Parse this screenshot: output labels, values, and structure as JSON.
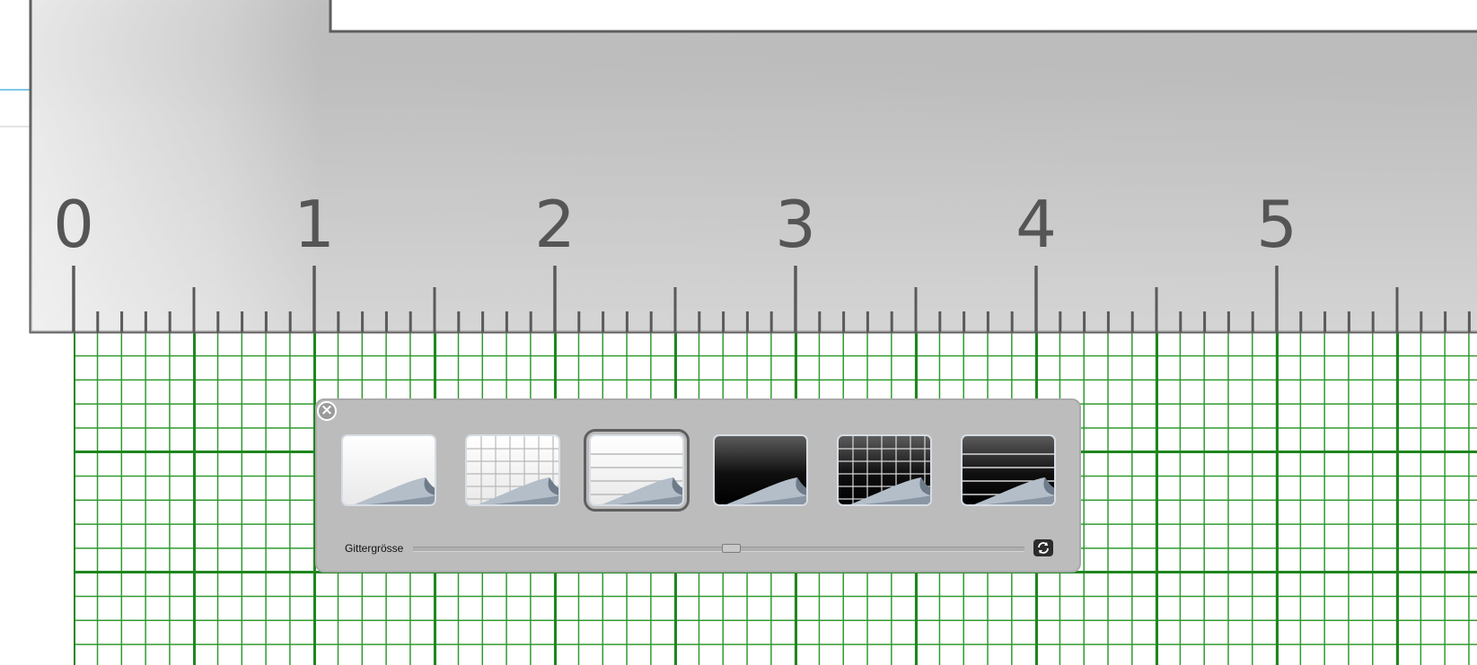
{
  "ruler": {
    "unit_labels": [
      "0",
      "1",
      "2",
      "3",
      "4",
      "5"
    ],
    "subdivisions_per_unit": 10
  },
  "background_panel": {
    "close_icon": "close-icon",
    "options": [
      {
        "name": "plain-white",
        "style": "light",
        "pattern": "none",
        "selected": false
      },
      {
        "name": "grid-white",
        "style": "light",
        "pattern": "grid",
        "selected": false
      },
      {
        "name": "lines-white",
        "style": "light",
        "pattern": "lines",
        "selected": true
      },
      {
        "name": "plain-black",
        "style": "dark",
        "pattern": "none",
        "selected": false
      },
      {
        "name": "grid-black",
        "style": "dark",
        "pattern": "grid",
        "selected": false
      },
      {
        "name": "lines-black",
        "style": "dark",
        "pattern": "lines",
        "selected": false
      }
    ],
    "grid_size_label": "Gittergrösse",
    "grid_size_value": 0.52,
    "reset_icon": "reset-icon"
  },
  "colors": {
    "grid_line": "#1f861f",
    "ruler": "#d8d8d8",
    "ruler_stroke": "#5a5a5a",
    "guide_line": "#7fc8e6"
  }
}
